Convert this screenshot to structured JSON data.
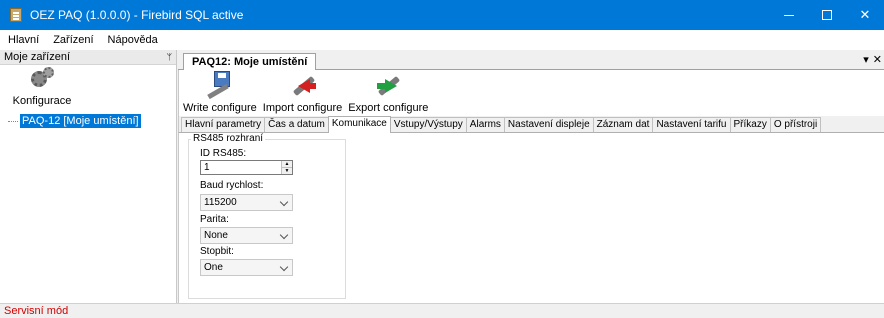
{
  "window": {
    "title": "OEZ PAQ (1.0.0.0) - Firebird SQL active",
    "buttons": {
      "minimize": "–",
      "maximize": "☐",
      "close": "✕"
    }
  },
  "menu": {
    "items": [
      "Hlavní",
      "Zařízení",
      "Nápověda"
    ]
  },
  "left_panel": {
    "title": "Moje zařízení",
    "pin": "ᛘ",
    "config_button": "Konfigurace",
    "tree_item": "PAQ-12 [Moje umístění]"
  },
  "document": {
    "tab_title": "PAQ12: Moje umístění",
    "controls": {
      "dropdown": "▾",
      "close": "✕"
    },
    "toolbar": {
      "write": "Write configure",
      "import": "Import configure",
      "export": "Export configure"
    },
    "tabs": [
      "Hlavní parametry",
      "Čas a datum",
      "Komunikace",
      "Vstupy/Výstupy",
      "Alarms",
      "Nastavení displeje",
      "Záznam dat",
      "Nastavení tarifu",
      "Příkazy",
      "O přístroji"
    ],
    "active_tab": "Komunikace"
  },
  "rs485": {
    "group_title": "RS485 rozhraní",
    "id_label": "ID RS485:",
    "id_value": "1",
    "baud_label": "Baud rychlost:",
    "baud_value": "115200",
    "parity_label": "Parita:",
    "parity_value": "None",
    "stopbit_label": "Stopbit:",
    "stopbit_value": "One"
  },
  "status": {
    "text": "Servisní mód"
  },
  "colors": {
    "accent": "#0078d7",
    "status_red": "#d00000",
    "import_arrow": "#d42020",
    "export_arrow": "#20a040"
  }
}
